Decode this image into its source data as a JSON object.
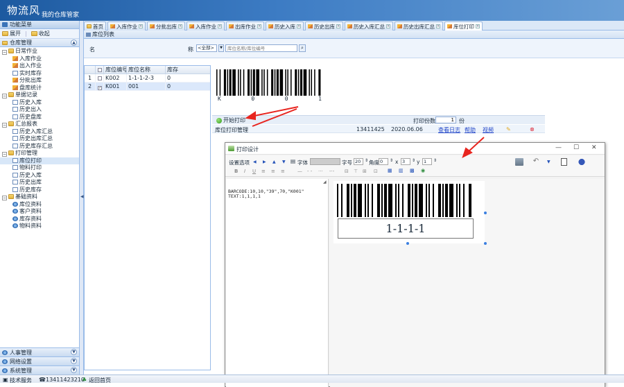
{
  "header": {
    "brand": "物流风",
    "slogan": "我的仓库管家"
  },
  "left_panel": {
    "title": "功能菜单",
    "toolbar": {
      "expand_label": "展开",
      "collapse_label": "收起"
    },
    "section_title": "仓库管理",
    "tree": [
      {
        "type": "group",
        "label": "日常作业"
      },
      {
        "type": "leaf",
        "label": "入库作业",
        "icon": "pencil"
      },
      {
        "type": "leaf",
        "label": "出入作业",
        "icon": "pencil"
      },
      {
        "type": "leaf",
        "label": "实时库存",
        "icon": "doc"
      },
      {
        "type": "leaf",
        "label": "分批出库",
        "icon": "pencil"
      },
      {
        "type": "leaf",
        "label": "盘库统计",
        "icon": "pencil"
      },
      {
        "type": "group",
        "label": "单据记录"
      },
      {
        "type": "leaf",
        "label": "历史入库",
        "icon": "doc"
      },
      {
        "type": "leaf",
        "label": "历史出入",
        "icon": "doc"
      },
      {
        "type": "leaf",
        "label": "历史盘库",
        "icon": "doc"
      },
      {
        "type": "group",
        "label": "汇总报表"
      },
      {
        "type": "leaf",
        "label": "历史入库汇总",
        "icon": "doc"
      },
      {
        "type": "leaf",
        "label": "历史出库汇总",
        "icon": "doc"
      },
      {
        "type": "leaf",
        "label": "历史库存汇总",
        "icon": "doc"
      },
      {
        "type": "group",
        "label": "打印管理"
      },
      {
        "type": "leaf",
        "label": "库位打印",
        "icon": "doc",
        "selected": true
      },
      {
        "type": "leaf",
        "label": "物料打印",
        "icon": "doc"
      },
      {
        "type": "leaf",
        "label": "历史入库",
        "icon": "doc"
      },
      {
        "type": "leaf",
        "label": "历史出库",
        "icon": "doc"
      },
      {
        "type": "leaf",
        "label": "历史库存",
        "icon": "doc"
      },
      {
        "type": "group",
        "label": "基础资料"
      },
      {
        "type": "leaf",
        "label": "库位资料",
        "icon": "gear"
      },
      {
        "type": "leaf",
        "label": "客户资料",
        "icon": "gear"
      },
      {
        "type": "leaf",
        "label": "库存资料",
        "icon": "gear"
      },
      {
        "type": "leaf",
        "label": "物料资料",
        "icon": "gear"
      }
    ],
    "bottom_sections": [
      "人事管理",
      "网络设置",
      "系统管理"
    ]
  },
  "tabs": [
    {
      "label": "首页",
      "active": false
    },
    {
      "label": "入库作业",
      "active": false
    },
    {
      "label": "分批出库",
      "active": false
    },
    {
      "label": "入库作业",
      "active": false
    },
    {
      "label": "出库作业",
      "active": false
    },
    {
      "label": "历史入库",
      "active": false
    },
    {
      "label": "历史出库",
      "active": false
    },
    {
      "label": "历史入库汇总",
      "active": false
    },
    {
      "label": "历史出库汇总",
      "active": false
    },
    {
      "label": "库位打印",
      "active": true
    }
  ],
  "panel_title": "库位列表",
  "search": {
    "label1": "名",
    "label2": "称",
    "select_value": "<全部>",
    "placeholder": "库位名称/库位编号"
  },
  "grid": {
    "headers": [
      "库位编号",
      "库位名称",
      "库存"
    ],
    "rows": [
      {
        "num": "1",
        "checked": false,
        "code": "K002",
        "name": "1-1-1-2-3",
        "qty": "0"
      },
      {
        "num": "2",
        "checked": true,
        "code": "K001",
        "name": "001",
        "qty": "0"
      }
    ]
  },
  "barcode_preview": {
    "chars": [
      "K",
      "0",
      "0",
      "1"
    ]
  },
  "print_row": {
    "print_label": "开始打印",
    "copies_label": "打印份数",
    "copies_value": "1",
    "copies_unit": "份"
  },
  "info_row": {
    "left_text": "库位打印管理",
    "phone": "13411425",
    "date": "2020.06.06",
    "link1": "查看日志",
    "link2": "帮助",
    "link3": "视频"
  },
  "dialog": {
    "title": "打印设计",
    "tb1": {
      "nav_label": "设置选项",
      "font_label": "字体",
      "size_label": "字号",
      "size_value": "20",
      "rotate_label": "角度",
      "rotate_value": "0",
      "x_label": "x",
      "x_value": "3",
      "y_label": "y",
      "y_value": "1"
    },
    "buttons": [
      "保存",
      "撤销",
      "打开",
      "打印"
    ],
    "command_text": "BARCODE:10,10,\"39\",70,\"K001\"\nTEXT:1,1,1,1"
  },
  "label_preview": {
    "text": "1-1-1-1"
  },
  "status": {
    "user_label": "技术服务",
    "phone": "13411423210",
    "home_label": "返回首页"
  }
}
